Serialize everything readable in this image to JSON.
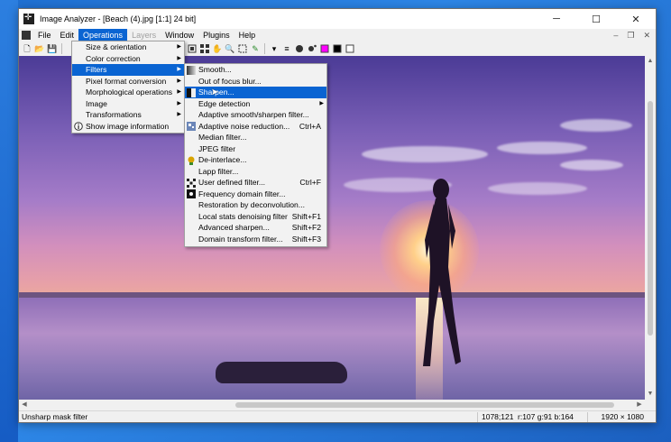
{
  "window": {
    "title": "Image Analyzer - [Beach (4).jpg [1:1] 24 bit]",
    "controls": {
      "minimize": "─",
      "maximize": "☐",
      "close": "✕"
    }
  },
  "menubar": {
    "items": [
      {
        "label": "File",
        "state": "normal"
      },
      {
        "label": "Edit",
        "state": "normal"
      },
      {
        "label": "Operations",
        "state": "active"
      },
      {
        "label": "Layers",
        "state": "disabled"
      },
      {
        "label": "Window",
        "state": "normal"
      },
      {
        "label": "Plugins",
        "state": "normal"
      },
      {
        "label": "Help",
        "state": "normal"
      }
    ],
    "mdi_controls": {
      "minimize": "‒",
      "restore": "❐",
      "close": "✕"
    }
  },
  "toolbar": {
    "icons": [
      "new-icon",
      "open-icon",
      "save-icon",
      "print-icon",
      "select-icon",
      "crop-icon",
      "hand-icon",
      "zoom-icon",
      "marquee-icon",
      "pencil-icon",
      "dropdown-icon",
      "line-width-icon",
      "brush-icon",
      "spray-icon",
      "color-magenta-icon",
      "color-black-icon",
      "color-white-icon"
    ],
    "glyphs": {
      "new": "🗋",
      "open": "📂",
      "save": "💾",
      "hand": "✋",
      "zoom": "🔍",
      "pencil": "✎",
      "dropdown": "▾",
      "lines": "≡",
      "brush": "●"
    },
    "colors": {
      "magenta": "#ff00ff",
      "black": "#000000",
      "white": "#ffffff"
    }
  },
  "operations_menu": {
    "items": [
      {
        "label": "Size & orientation",
        "submenu": true
      },
      {
        "label": "Color correction",
        "submenu": true
      },
      {
        "label": "Filters",
        "submenu": true,
        "highlighted": true
      },
      {
        "label": "Pixel format conversion",
        "submenu": true
      },
      {
        "label": "Morphological operations",
        "submenu": true
      },
      {
        "label": "Image",
        "submenu": true
      },
      {
        "label": "Transformations",
        "submenu": true
      },
      {
        "label": "Show image information",
        "submenu": false,
        "icon": "info-icon"
      }
    ]
  },
  "filters_menu": {
    "items": [
      {
        "label": "Smooth...",
        "shortcut": "",
        "icon": "smooth-icon"
      },
      {
        "label": "Out of focus blur...",
        "shortcut": ""
      },
      {
        "label": "Sharpen...",
        "shortcut": "",
        "icon": "sharpen-icon",
        "highlighted": true
      },
      {
        "label": "Edge detection",
        "shortcut": "",
        "submenu": true
      },
      {
        "label": "Adaptive smooth/sharpen filter...",
        "shortcut": ""
      },
      {
        "label": "Adaptive noise reduction...",
        "shortcut": "Ctrl+A",
        "icon": "noise-icon"
      },
      {
        "label": "Median filter...",
        "shortcut": ""
      },
      {
        "label": "JPEG filter",
        "shortcut": ""
      },
      {
        "label": "De-interlace...",
        "shortcut": "",
        "icon": "deinterlace-icon"
      },
      {
        "label": "Lapp filter...",
        "shortcut": ""
      },
      {
        "label": "User defined filter...",
        "shortcut": "Ctrl+F",
        "icon": "user-filter-icon"
      },
      {
        "label": "Frequency domain filter...",
        "shortcut": "",
        "icon": "frequency-icon"
      },
      {
        "label": "Restoration by deconvolution...",
        "shortcut": ""
      },
      {
        "label": "Local stats denoising filter",
        "shortcut": "Shift+F1"
      },
      {
        "label": "Advanced sharpen...",
        "shortcut": "Shift+F2"
      },
      {
        "label": "Domain transform filter...",
        "shortcut": "Shift+F3"
      }
    ]
  },
  "statusbar": {
    "message": "Unsharp mask filter",
    "coords": "1078;121",
    "rgb": "r:107 g:91 b:164",
    "size": "1920 × 1080"
  },
  "scroll": {
    "up": "▲",
    "down": "▼",
    "left": "◀",
    "right": "▶"
  },
  "submenu_arrow": "▶"
}
